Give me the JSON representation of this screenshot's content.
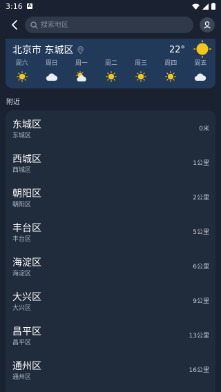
{
  "status_bar": {
    "time": "3:16",
    "app_icon": "A"
  },
  "search": {
    "placeholder": "搜索地区"
  },
  "current": {
    "city": "北京市 东城区",
    "temperature": "22°",
    "icon": "sun-icon"
  },
  "forecast": [
    {
      "day": "周六",
      "icon": "sun-icon"
    },
    {
      "day": "周日",
      "icon": "cloud-icon"
    },
    {
      "day": "周一",
      "icon": "partly-cloudy-icon"
    },
    {
      "day": "周二",
      "icon": "sun-icon"
    },
    {
      "day": "周三",
      "icon": "sun-icon"
    },
    {
      "day": "周四",
      "icon": "sun-icon"
    },
    {
      "day": "周五",
      "icon": "cloud-icon"
    }
  ],
  "nearby_label": "附近",
  "nearby": [
    {
      "name": "东城区",
      "sub": "东城区",
      "distance": "0米"
    },
    {
      "name": "西城区",
      "sub": "西城区",
      "distance": "1公里"
    },
    {
      "name": "朝阳区",
      "sub": "朝阳区",
      "distance": "2公里"
    },
    {
      "name": "丰台区",
      "sub": "丰台区",
      "distance": "5公里"
    },
    {
      "name": "海淀区",
      "sub": "海淀区",
      "distance": "6公里"
    },
    {
      "name": "大兴区",
      "sub": "大兴区",
      "distance": "9公里"
    },
    {
      "name": "昌平区",
      "sub": "昌平区",
      "distance": "13公里"
    },
    {
      "name": "通州区",
      "sub": "通州区",
      "distance": "16公里"
    }
  ],
  "colors": {
    "background": "#1a2232",
    "weather_card": "#223a5a",
    "list_card": "#202b3b",
    "sun": "#f5c518"
  }
}
